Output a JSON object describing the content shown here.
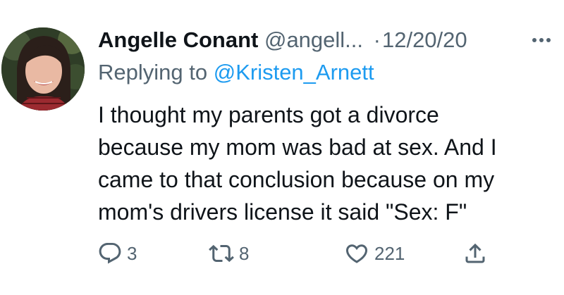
{
  "tweet": {
    "author_name": "Angelle Conant",
    "author_handle": "@angell...",
    "separator": "·",
    "date": "12/20/20",
    "reply_prefix": "Replying to",
    "reply_to": "@Kristen_Arnett",
    "text_lines": [
      "I thought my parents got a divorce",
      "because my mom was bad at sex. And I",
      "came to that conclusion because on my",
      "mom's drivers license it said \"Sex: F\""
    ]
  },
  "actions": {
    "reply": {
      "icon": "reply-icon",
      "count": "3"
    },
    "retweet": {
      "icon": "retweet-icon",
      "count": "8"
    },
    "like": {
      "icon": "heart-icon",
      "count": "221"
    },
    "share": {
      "icon": "share-icon",
      "count": ""
    }
  },
  "colors": {
    "text": "#0f1419",
    "secondary": "#536471",
    "accent": "#1d9bf0",
    "background": "#ffffff"
  }
}
